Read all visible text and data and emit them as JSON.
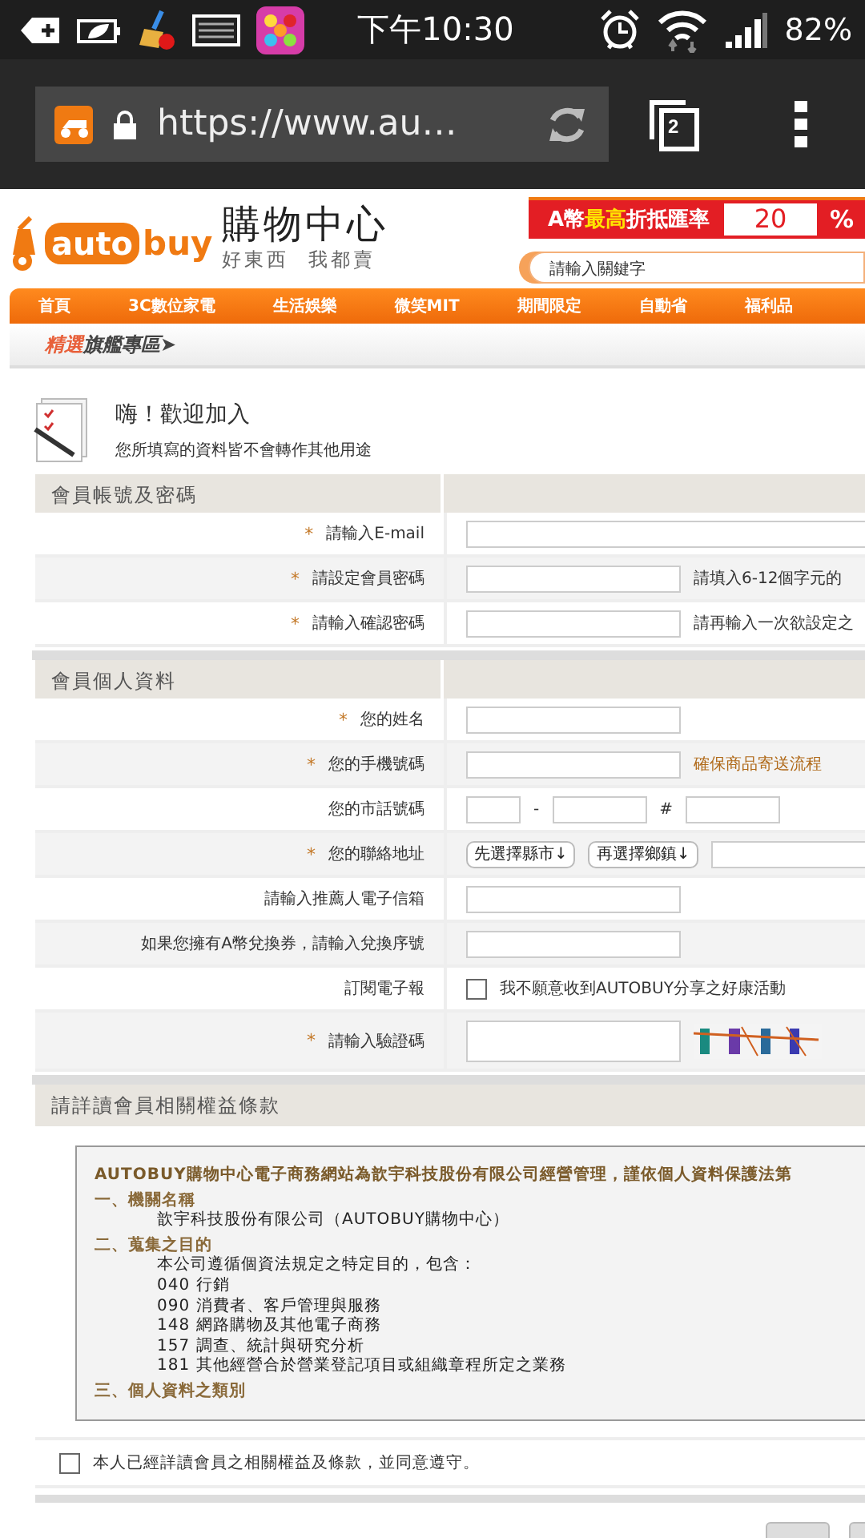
{
  "status_bar": {
    "time": "下午10:30",
    "battery": "82%"
  },
  "browser": {
    "url": "https://www.au…",
    "tab_count": "2"
  },
  "header": {
    "logo": {
      "part_a": "auto",
      "part_b": "buy"
    },
    "site_name": "購物中心",
    "slogan": "好東西  我都賣",
    "promo": {
      "parts": [
        {
          "text": "A幣",
          "highlight": false
        },
        {
          "text": "最高",
          "highlight": true
        },
        {
          "text": "折抵匯率",
          "highlight": false
        }
      ],
      "rate": "20",
      "unit": "%"
    },
    "search": {
      "placeholder": "請輸入關鍵字"
    }
  },
  "nav": [
    {
      "label": "首頁"
    },
    {
      "label": "3C數位家電"
    },
    {
      "label": "生活娛樂"
    },
    {
      "label": "微笑MIT"
    },
    {
      "label": "期間限定"
    },
    {
      "label": "自動省"
    },
    {
      "label": "福利品"
    }
  ],
  "featured": {
    "accent": "精選",
    "rest": "旗艦專區",
    "arrow": "➤"
  },
  "welcome": {
    "title": "嗨！歡迎加入",
    "subtitle": "您所填寫的資料皆不會轉作其他用途"
  },
  "sections": [
    {
      "title": "會員帳號及密碼",
      "rows": [
        {
          "kind": "wide-input",
          "label": "請輸入E-mail",
          "required_mark": "*"
        },
        {
          "kind": "input",
          "label": "請設定會員密碼",
          "required_mark": "*",
          "hint": "請填入6-12個字元的",
          "hint_alert": false
        },
        {
          "kind": "input",
          "label": "請輸入確認密碼",
          "required_mark": "*",
          "hint": "請再輸入一次欲設定之",
          "hint_alert": false
        }
      ]
    },
    {
      "title": "會員個人資料",
      "rows": [
        {
          "kind": "input",
          "label": "您的姓名",
          "required_mark": "*"
        },
        {
          "kind": "input",
          "label": "您的手機號碼",
          "required_mark": "*",
          "hint": "確保商品寄送流程",
          "hint_alert": true
        },
        {
          "kind": "phone",
          "label": "您的市話號碼",
          "separators": [
            "-",
            "#"
          ]
        },
        {
          "kind": "address",
          "label": "您的聯絡地址",
          "required_mark": "*",
          "selects": [
            "先選擇縣市↓",
            "再選擇鄉鎮↓"
          ]
        },
        {
          "kind": "input",
          "label": "請輸入推薦人電子信箱"
        },
        {
          "kind": "input",
          "label": "如果您擁有A幣兌換券，請輸入兌換序號"
        },
        {
          "kind": "checkbox",
          "label": "訂閱電子報",
          "option": "我不願意收到AUTOBUY分享之好康活動",
          "checked": false
        },
        {
          "kind": "captcha",
          "label": "請輸入驗證碼",
          "required_mark": "*"
        }
      ]
    }
  ],
  "terms": {
    "title": "請詳讀會員相關權益條款",
    "lines": [
      {
        "kind": "lead",
        "text": "AUTOBUY購物中心電子商務網站為歆宇科技股份有限公司經營管理，謹依個人資料保護法第"
      },
      {
        "kind": "heading",
        "text": "一、機關名稱"
      },
      {
        "kind": "body",
        "text": "歆宇科技股份有限公司（AUTOBUY購物中心）"
      },
      {
        "kind": "heading",
        "text": "二、蒐集之目的"
      },
      {
        "kind": "body",
        "text": "本公司遵循個資法規定之特定目的，包含："
      },
      {
        "kind": "body",
        "text": "040 行銷"
      },
      {
        "kind": "body",
        "text": "090 消費者、客戶管理與服務"
      },
      {
        "kind": "body",
        "text": "148 網路購物及其他電子商務"
      },
      {
        "kind": "body",
        "text": "157 調查、統計與研究分析"
      },
      {
        "kind": "body",
        "text": "181 其他經營合於營業登記項目或組織章程所定之業務"
      },
      {
        "kind": "heading",
        "text": "三、個人資料之類別"
      }
    ],
    "agreement": {
      "text": "本人已經詳讀會員之相關權益及條款，並同意遵守。",
      "checked": false
    }
  }
}
